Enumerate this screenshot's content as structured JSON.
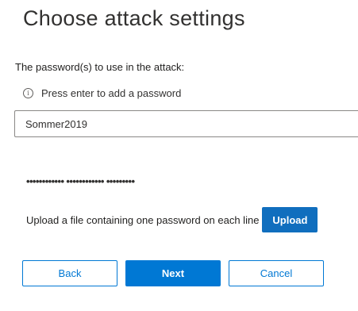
{
  "page": {
    "title": "Choose attack settings"
  },
  "passwords_section": {
    "label": "The password(s) to use in the attack:",
    "hint": "Press enter to add a password",
    "input_value": "Sommer2019",
    "masked_passwords": "•••••••••••• •••••••••••• •••••••••"
  },
  "upload": {
    "text": "Upload a file containing one password on each line",
    "button_label": "Upload"
  },
  "footer": {
    "back_label": "Back",
    "next_label": "Next",
    "cancel_label": "Cancel"
  },
  "icons": {
    "info": "info-icon"
  },
  "colors": {
    "primary": "#0078d4",
    "text": "#323130"
  }
}
